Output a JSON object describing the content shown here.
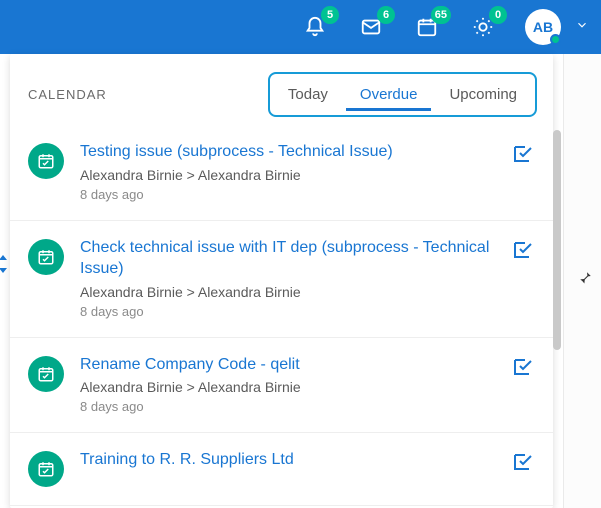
{
  "topbar": {
    "notifications_badge": "5",
    "messages_badge": "6",
    "calendar_badge": "65",
    "brightness_badge": "0",
    "avatar_initials": "AB"
  },
  "panel": {
    "title": "CALENDAR",
    "tabs": [
      {
        "label": "Today"
      },
      {
        "label": "Overdue"
      },
      {
        "label": "Upcoming"
      }
    ],
    "active_tab": 1
  },
  "items": [
    {
      "title": "Testing issue (subprocess - Technical Issue)",
      "sub": "Alexandra Birnie  >  Alexandra Birnie",
      "time": "8 days ago"
    },
    {
      "title": "Check technical issue with IT dep (subprocess - Technical Issue)",
      "sub": "Alexandra Birnie  >  Alexandra Birnie",
      "time": "8 days ago"
    },
    {
      "title": "Rename Company Code - qelit",
      "sub": "Alexandra Birnie  >  Alexandra Birnie",
      "time": "8 days ago"
    },
    {
      "title": "Training to R. R. Suppliers Ltd",
      "sub": "",
      "time": ""
    }
  ]
}
